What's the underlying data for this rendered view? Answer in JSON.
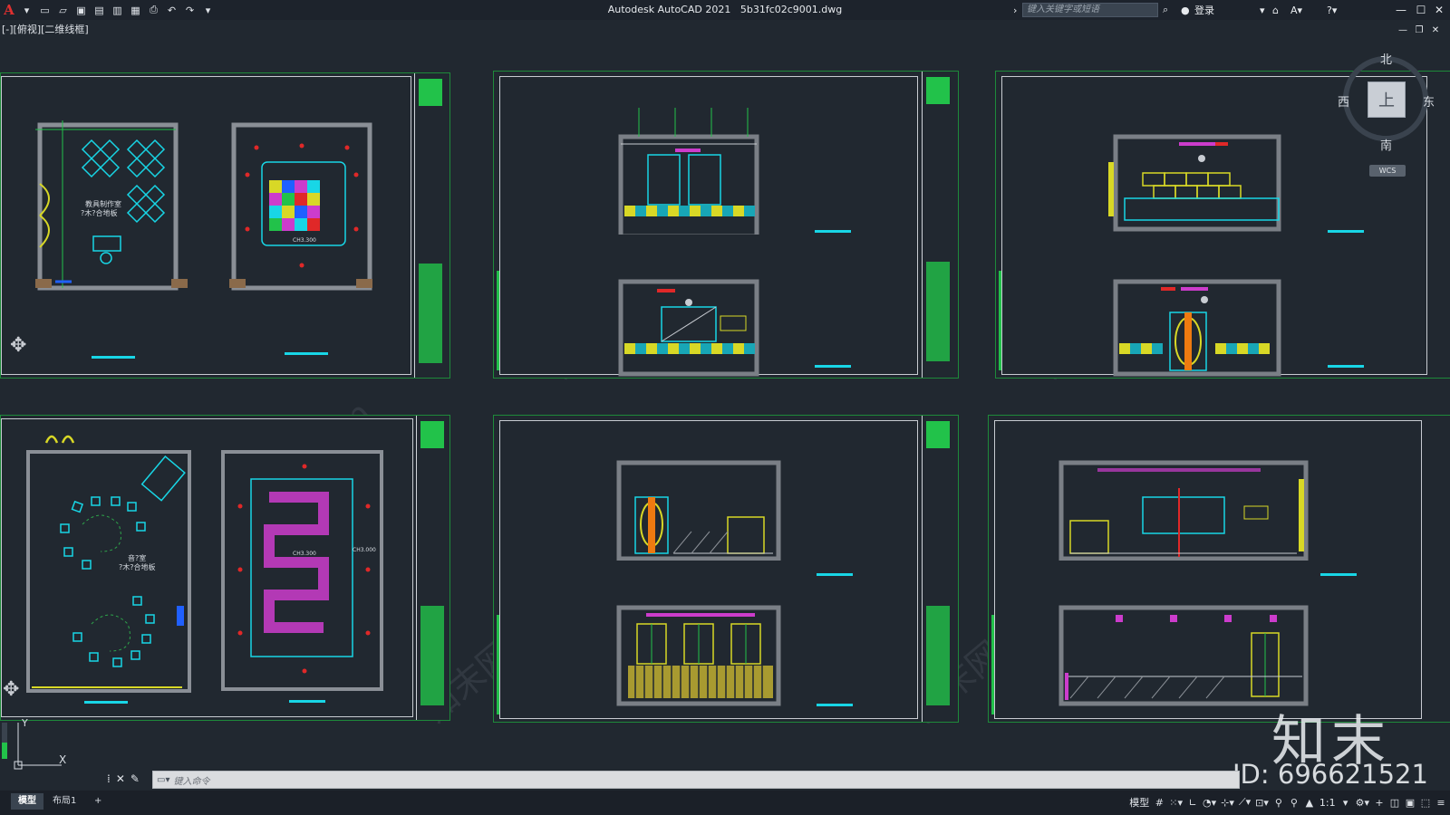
{
  "app": {
    "title": "Autodesk AutoCAD 2021",
    "filename": "5b31fc02c9001.dwg",
    "search_placeholder": "键入关键字或短语",
    "login_label": "登录",
    "viewport_label": "[-][俯视][二维线框]"
  },
  "quick_access": [
    "new-icon",
    "open-icon",
    "save-icon",
    "saveas-icon",
    "publish-icon",
    "plot-preview-icon",
    "print-icon",
    "undo-icon",
    "redo-icon",
    "customize-icon"
  ],
  "viewcube": {
    "north": "北",
    "south": "南",
    "west": "西",
    "east": "东",
    "face": "上",
    "wcs": "WCS"
  },
  "drawing": {
    "room1_label_line1": "教具制作室",
    "room1_label_line2": "?木?合地板",
    "room2_label_line1": "音?室",
    "room2_label_line2": "?木?合地板",
    "level_label": "CH3.300",
    "level_label2": "CH3.000"
  },
  "watermark": {
    "text": "知末网www.znzmo.com",
    "brand": "知末",
    "id_text": "ID: 696621521"
  },
  "command": {
    "placeholder": "键入命令"
  },
  "layout_tabs": [
    {
      "label": "模型",
      "active": true
    },
    {
      "label": "布局1",
      "active": false
    },
    {
      "label": "+",
      "active": false
    }
  ],
  "status": {
    "model_label": "模型",
    "scale": "1:1"
  },
  "colors": {
    "background": "#212830",
    "sheet_border": "#1e8a3a",
    "cyan": "#18d6e6",
    "green": "#22c24a",
    "yellow": "#d8d826",
    "magenta": "#cc3ccc",
    "red": "#e02828",
    "orange": "#ee7a10"
  }
}
